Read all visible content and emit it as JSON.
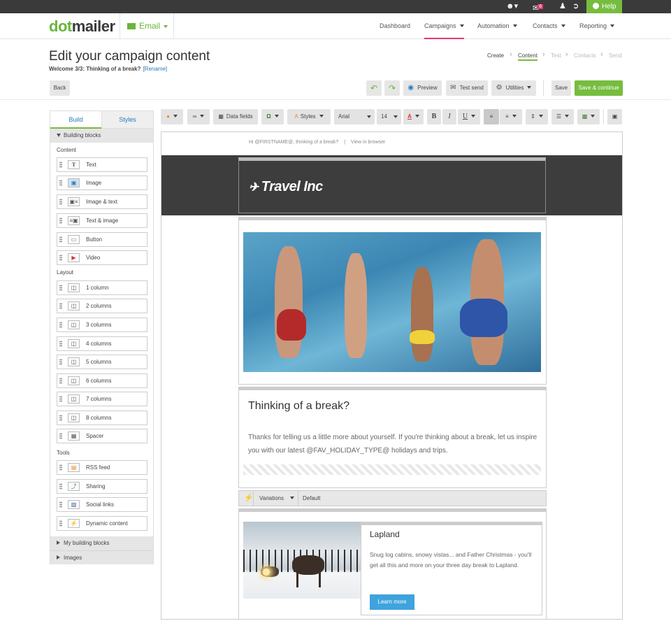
{
  "topbar": {
    "notification_count": "6",
    "help_label": "Help"
  },
  "nav": {
    "logo_dot": "dot",
    "logo_mailer": "mailer",
    "product": "Email",
    "items": [
      {
        "label": "Dashboard"
      },
      {
        "label": "Campaigns"
      },
      {
        "label": "Automation"
      },
      {
        "label": "Contacts"
      },
      {
        "label": "Reporting"
      }
    ]
  },
  "page": {
    "title": "Edit your campaign content",
    "campaign_name": "Welcome 3/3: Thinking of a break?",
    "rename_label": "[Rename]"
  },
  "steps": [
    "Create",
    "Content",
    "Test",
    "Contacts",
    "Send"
  ],
  "actions": {
    "back": "Back",
    "preview": "Preview",
    "test_send": "Test send",
    "utilities": "Utilities",
    "save": "Save",
    "save_continue": "Save & continue"
  },
  "sidebar": {
    "tab_build": "Build",
    "tab_styles": "Styles",
    "building_blocks": "Building blocks",
    "content_label": "Content",
    "content_blocks": [
      "Text",
      "Image",
      "Image & text",
      "Text & image",
      "Button",
      "Video"
    ],
    "layout_label": "Layout",
    "layout_blocks": [
      "1 column",
      "2 columns",
      "3 columns",
      "4 columns",
      "5 columns",
      "6 columns",
      "7 columns",
      "8 columns",
      "Spacer"
    ],
    "tools_label": "Tools",
    "tool_blocks": [
      "RSS feed",
      "Sharing",
      "Social links",
      "Dynamic content"
    ],
    "my_blocks": "My building blocks",
    "images": "Images"
  },
  "toolbar": {
    "data_fields": "Data fields",
    "omega": "Ω",
    "styles": "Styles",
    "font": "Arial",
    "size": "14",
    "bold": "B",
    "italic": "I",
    "underline": "U"
  },
  "email": {
    "greeting": "Hi @FIRSTNAME@, thinking of a break?",
    "separator": "|",
    "view_in_browser": "View in browser",
    "brand": "Travel Inc",
    "headline": "Thinking of a break?",
    "body": "Thanks for telling us a little more about yourself. If you're thinking about a break, let us inspire you with our latest @FAV_HOLIDAY_TYPE@ holidays and trips.",
    "variations_label": "Variations",
    "variation_value": "Default",
    "card_title": "Lapland",
    "card_body": "Snug log cabins, snowy vistas... and Father Christmas - you'll get all this and more on your three day break to Lapland.",
    "card_button": "Learn more"
  },
  "colors": {
    "brand_green": "#76bd3f",
    "active_pink": "#e6357a",
    "link_blue": "#2a7ab8",
    "button_blue": "#3fa3dd",
    "header_dark": "#3d3d3d"
  }
}
